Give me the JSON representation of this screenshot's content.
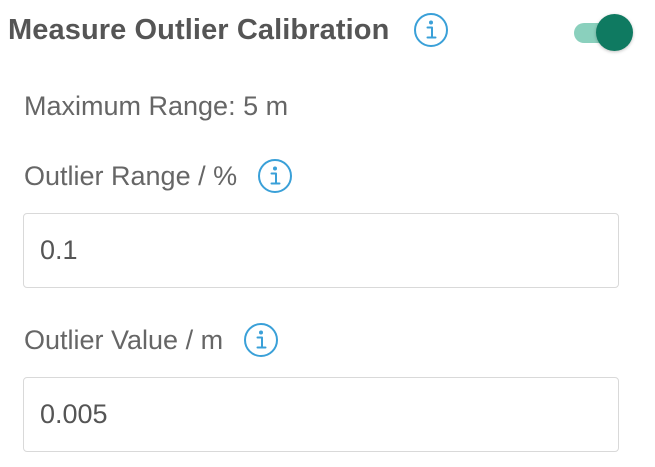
{
  "section": {
    "title": "Measure Outlier Calibration",
    "info_icon": "info-circle-icon",
    "toggle": {
      "state": "on",
      "accent_color": "#0f7a61",
      "track_color": "#8ad0bd"
    }
  },
  "maximum_range": {
    "label": "Maximum Range: 5 m"
  },
  "outlier_range": {
    "label": "Outlier Range / %",
    "info_icon": "info-circle-icon",
    "value": "0.1"
  },
  "outlier_value": {
    "label": "Outlier Value / m",
    "info_icon": "info-circle-icon",
    "value": "0.005"
  },
  "colors": {
    "info_icon": "#3aa0d8",
    "text": "#666666",
    "title": "#555555",
    "field_border": "#d9d9d9"
  }
}
